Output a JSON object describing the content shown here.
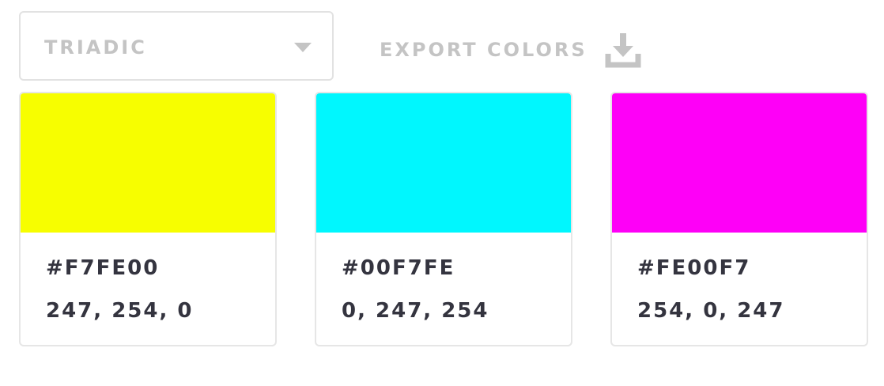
{
  "scheme_select": {
    "selected": "TRIADIC"
  },
  "export": {
    "label": "EXPORT COLORS",
    "icon": "download-icon"
  },
  "colors": [
    {
      "hex": "#F7FE00",
      "rgb": "247, 254, 0",
      "swatch": "#F7FE00"
    },
    {
      "hex": "#00F7FE",
      "rgb": "0, 247, 254",
      "swatch": "#00F7FE"
    },
    {
      "hex": "#FE00F7",
      "rgb": "254, 0, 247",
      "swatch": "#FE00F7"
    }
  ],
  "theme": {
    "muted_text": "#c4c4c4",
    "value_text": "#34343f",
    "border": "#e2e2e2"
  }
}
